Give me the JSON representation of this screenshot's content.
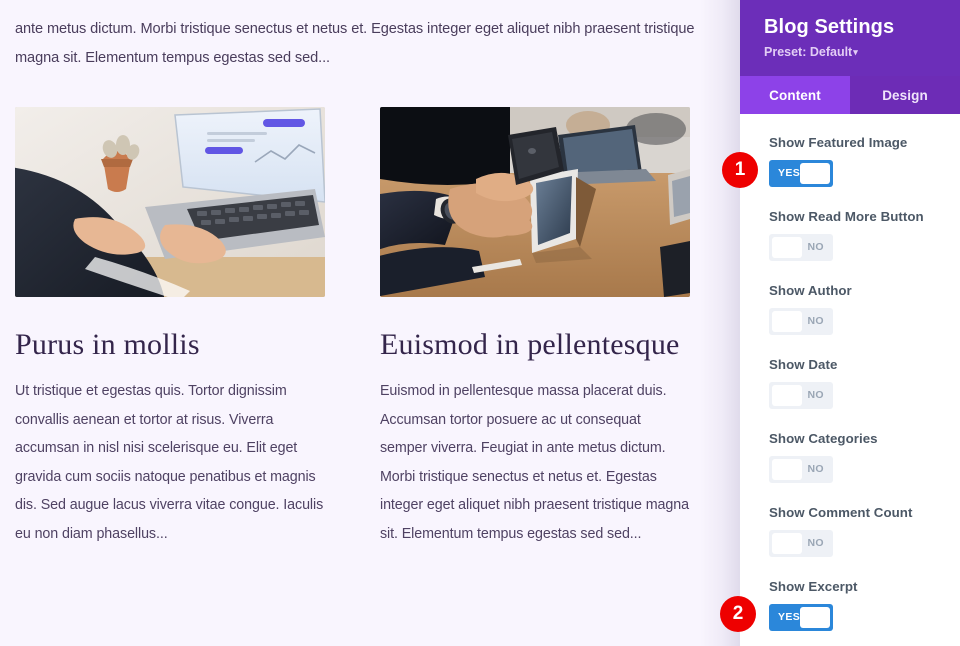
{
  "preview": {
    "intro_paragraph": "ante metus dictum. Morbi tristique senectus et netus et. Egestas integer eget aliquet nibh praesent tristique magna sit. Elementum tempus egestas sed sed...",
    "posts": [
      {
        "image_alt": "person in suit typing on a laptop at a desk with a small potted plant",
        "title": "Purus in mollis",
        "excerpt": "Ut tristique et egestas quis. Tortor dignissim convallis aenean et tortor at risus. Viverra accumsan in nisl nisi scelerisque eu. Elit eget gravida cum sociis natoque penatibus et magnis dis. Sed augue lacus viverra vitae congue. Iaculis eu non diam phasellus..."
      },
      {
        "image_alt": "hands holding a smartphone above a tablet on a wooden conference table",
        "title": "Euismod in pellentesque",
        "excerpt": "Euismod in pellentesque massa placerat duis. Accumsan tortor posuere ac ut consequat semper viverra. Feugiat in ante metus dictum. Morbi tristique senectus et netus et. Egestas integer eget aliquet nibh praesent tristique magna sit. Elementum tempus egestas sed sed..."
      }
    ]
  },
  "panel": {
    "title": "Blog Settings",
    "preset_label": "Preset: Default",
    "preset_caret": "▾",
    "tabs": [
      {
        "label": "Content",
        "active": true
      },
      {
        "label": "Design",
        "active": false
      }
    ],
    "settings": [
      {
        "label": "Show Featured Image",
        "state": "YES"
      },
      {
        "label": "Show Read More Button",
        "state": "NO"
      },
      {
        "label": "Show Author",
        "state": "NO"
      },
      {
        "label": "Show Date",
        "state": "NO"
      },
      {
        "label": "Show Categories",
        "state": "NO"
      },
      {
        "label": "Show Comment Count",
        "state": "NO"
      },
      {
        "label": "Show Excerpt",
        "state": "YES"
      }
    ]
  },
  "annotations": {
    "badges": [
      {
        "number": "1"
      },
      {
        "number": "2"
      }
    ]
  },
  "colors": {
    "panel_header": "#6c2eb9",
    "tab_active": "#8d42e8",
    "tab_inactive": "#6d2cb6",
    "toggle_on": "#2b87da",
    "toggle_off": "#eef1f6",
    "badge": "#ee0000",
    "preview_background": "#f9f5fe"
  }
}
